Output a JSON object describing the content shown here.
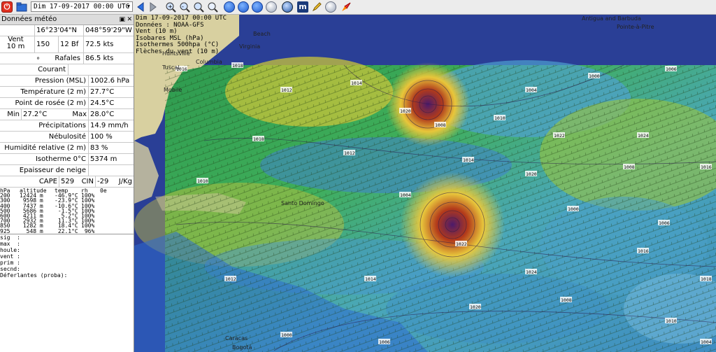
{
  "toolbar": {
    "date_value": "Dim 17-09-2017 00:00 UTC",
    "buttons": [
      "close-app",
      "open-file",
      "back",
      "forward",
      "zoom-in",
      "zoom-out",
      "zoom-fit",
      "zoom-sel",
      "nav-left",
      "nav-right",
      "nav-up",
      "nav-down",
      "globe",
      "m-logo",
      "pencil",
      "refresh",
      "rocket"
    ]
  },
  "panel": {
    "title": "Données météo",
    "lat": "16°23'04\"N",
    "lon": "048°59'29\"W",
    "wind_label_1": "Vent",
    "wind_label_2": "10 m",
    "wind_dir": "150 °",
    "wind_bf": "12 Bf",
    "wind_speed": "72.5  kts",
    "gust_label": "Rafales",
    "gust_value": "86.5  kts",
    "current_label": "Courant",
    "current_value": "",
    "pressure_label": "Pression (MSL)",
    "pressure_value": "1002.6 hPa",
    "temp_label": "Température (2 m)",
    "temp_value": "27.7°C",
    "dew_label": "Point de rosée (2 m)",
    "dew_value": "24.5°C",
    "min_label": "Min",
    "min_value": "27.2°C",
    "max_label": "Max",
    "max_value": "28.0°C",
    "precip_label": "Précipitations",
    "precip_value": "14.9 mm/h",
    "cloud_label": "Nébulosité",
    "cloud_value": "100 %",
    "hum_label": "Humidité relative (2 m)",
    "hum_value": "83 %",
    "iso_label": "Isotherme 0°C",
    "iso_value": "5374 m",
    "snow_label": "Epaisseur de neige",
    "snow_value": "",
    "cape_label": "CAPE",
    "cape_value": "529",
    "cin_label": "CIN",
    "cin_value": "-29",
    "jkg_label": "J/Kg",
    "alt_table": {
      "header": [
        "hPa",
        "altitude",
        "temp",
        "rh",
        "0e"
      ],
      "rows": [
        [
          "200",
          "12424 m",
          "-46.9°C",
          "100%",
          ""
        ],
        [
          "300",
          " 9598 m",
          "-23.9°C",
          "100%",
          ""
        ],
        [
          "400",
          " 7437 m",
          "-10.6°C",
          "100%",
          ""
        ],
        [
          "500",
          " 5686 m",
          " -1.5°C",
          "100%",
          ""
        ],
        [
          "600",
          " 4211 m",
          "  5.2°C",
          "100%",
          ""
        ],
        [
          "700",
          " 2932 m",
          " 11.3°C",
          "100%",
          ""
        ],
        [
          "850",
          " 1282 m",
          " 18.4°C",
          "100%",
          ""
        ],
        [
          "925",
          "  548 m",
          " 22.1°C",
          " 96%",
          ""
        ]
      ]
    },
    "wave_table": [
      "sig  :",
      "max  :",
      "houle:",
      "vent :",
      "prim :",
      "secnd:",
      "Déferlantes (proba):"
    ]
  },
  "map": {
    "info_lines": [
      "Dim 17-09-2017 00:00 UTC",
      "Données : NOAA-GFS",
      "Vent (10 m)",
      "Isobares MSL (hPa)",
      "Isothermes 500hpa (°C)",
      "Flèches du vent (10 m)"
    ],
    "place_labels": [
      "Huntsville",
      "Columbia",
      "Tuscal",
      "Mobile",
      "Beach",
      "Virginia",
      "Antigua and Barbuda",
      "Pointe-à-Pitre",
      "Santo Domingo",
      "Caracas",
      "Bogotá"
    ],
    "isobars": [
      "1016",
      "1018",
      "1012",
      "1014",
      "1020",
      "1008",
      "1010",
      "1004",
      "1000",
      "1006",
      "1022",
      "1024"
    ],
    "colors": {
      "sea": "#2a3f96",
      "land": "#d8d0a0"
    }
  }
}
